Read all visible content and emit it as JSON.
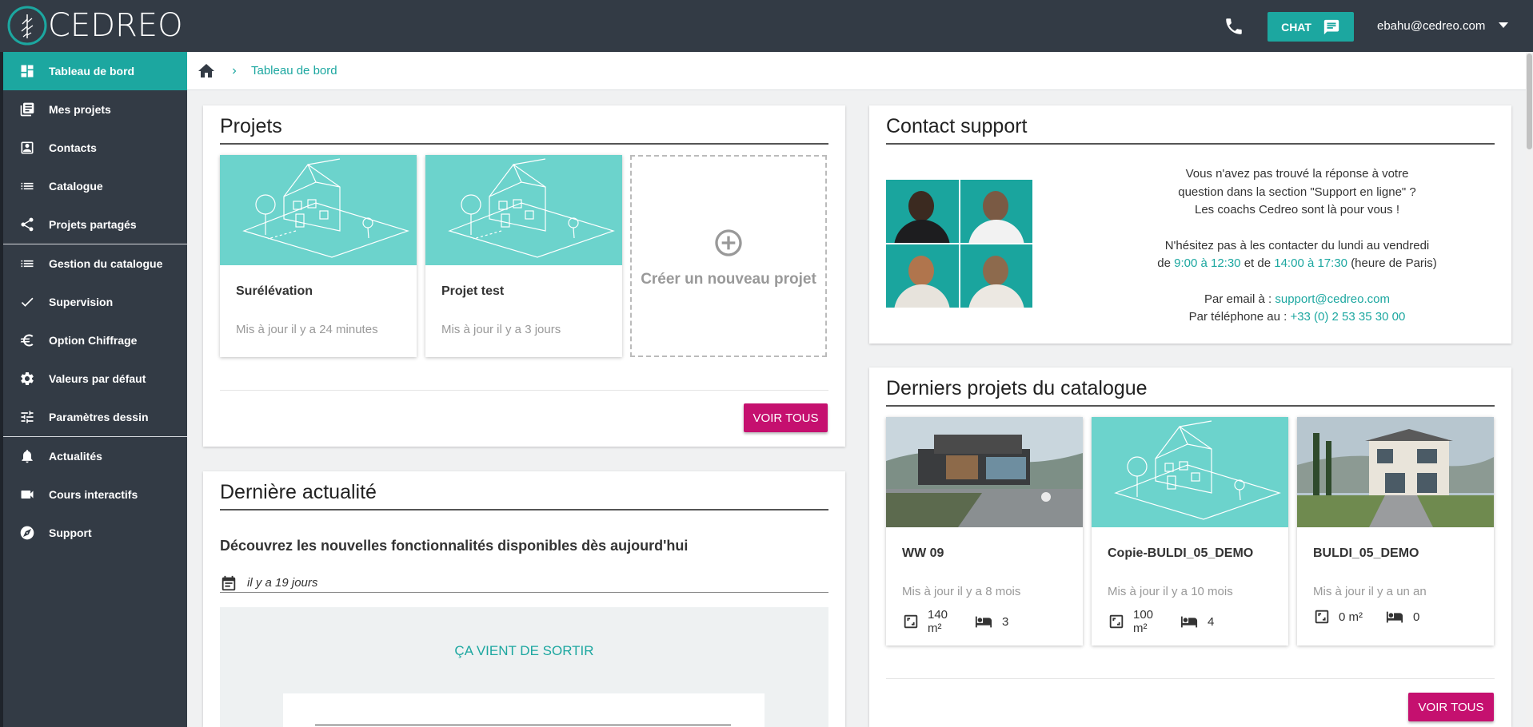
{
  "header": {
    "logo_text": "CEDREO",
    "chat_label": "CHAT",
    "user_email": "ebahu@cedreo.com"
  },
  "sidebar": {
    "items": [
      {
        "label": "Tableau de bord",
        "icon": "dashboard-icon"
      },
      {
        "label": "Mes projets",
        "icon": "projects-icon"
      },
      {
        "label": "Contacts",
        "icon": "contacts-icon"
      },
      {
        "label": "Catalogue",
        "icon": "list-icon"
      },
      {
        "label": "Projets partagés",
        "icon": "share-icon"
      },
      {
        "label": "Gestion du catalogue",
        "icon": "list-icon"
      },
      {
        "label": "Supervision",
        "icon": "check-icon"
      },
      {
        "label": "Option Chiffrage",
        "icon": "euro-icon"
      },
      {
        "label": "Valeurs par défaut",
        "icon": "gear-icon"
      },
      {
        "label": "Paramètres dessin",
        "icon": "sliders-icon"
      },
      {
        "label": "Actualités",
        "icon": "bell-icon"
      },
      {
        "label": "Cours interactifs",
        "icon": "video-icon"
      },
      {
        "label": "Support",
        "icon": "compass-icon"
      }
    ]
  },
  "breadcrumb": {
    "current": "Tableau de bord"
  },
  "projets": {
    "title": "Projets",
    "items": [
      {
        "name": "Surélévation",
        "updated": "Mis à jour il y a 24 minutes"
      },
      {
        "name": "Projet test",
        "updated": "Mis à jour il y a 3 jours"
      }
    ],
    "new_label": "Créer un nouveau projet",
    "voir_tous": "VOIR TOUS"
  },
  "actualite": {
    "title": "Dernière actualité",
    "headline": "Découvrez les nouvelles fonctionnalités disponibles dès aujourd'hui",
    "date": "il y a 19 jours",
    "banner_tag": "ÇA VIENT DE SORTIR"
  },
  "support": {
    "title": "Contact support",
    "line1": "Vous n'avez pas trouvé la réponse à votre",
    "line2": "question dans la section \"Support en ligne\" ?",
    "line3": "Les coachs Cedreo sont là pour vous !",
    "line4": "N'hésitez pas à les contacter du lundi au vendredi",
    "hours_de": "de",
    "hours_1": "9:00 à 12:30",
    "hours_et": "et de",
    "hours_2": "14:00 à 17:30",
    "hours_tz": "(heure de Paris)",
    "email_label": "Par email à :",
    "email": "support@cedreo.com",
    "phone_label": "Par téléphone au :",
    "phone": "+33 (0) 2 53 35 30 00"
  },
  "derniers": {
    "title": "Derniers projets du catalogue",
    "items": [
      {
        "name": "WW 09",
        "updated": "Mis à jour il y a 8 mois",
        "area": "140 m²",
        "rooms": "3"
      },
      {
        "name": "Copie-BULDI_05_DEMO",
        "updated": "Mis à jour il y a 10 mois",
        "area": "100 m²",
        "rooms": "4"
      },
      {
        "name": "BULDI_05_DEMO",
        "updated": "Mis à jour il y a un an",
        "area": "0 m²",
        "rooms": "0"
      }
    ],
    "voir_tous": "VOIR TOUS"
  },
  "colors": {
    "accent": "#1ca7a0",
    "sidebar": "#333b45",
    "button": "#c5106f",
    "thumb": "#6cd3cc"
  }
}
